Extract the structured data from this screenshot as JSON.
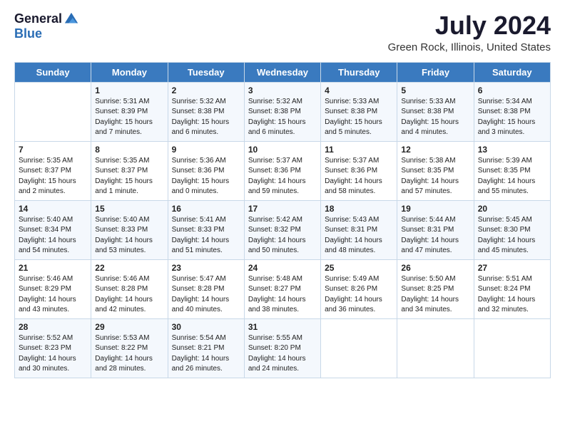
{
  "logo": {
    "general": "General",
    "blue": "Blue"
  },
  "title": {
    "month_year": "July 2024",
    "location": "Green Rock, Illinois, United States"
  },
  "headers": [
    "Sunday",
    "Monday",
    "Tuesday",
    "Wednesday",
    "Thursday",
    "Friday",
    "Saturday"
  ],
  "weeks": [
    [
      {
        "day": "",
        "sunrise": "",
        "sunset": "",
        "daylight": ""
      },
      {
        "day": "1",
        "sunrise": "Sunrise: 5:31 AM",
        "sunset": "Sunset: 8:39 PM",
        "daylight": "Daylight: 15 hours and 7 minutes."
      },
      {
        "day": "2",
        "sunrise": "Sunrise: 5:32 AM",
        "sunset": "Sunset: 8:38 PM",
        "daylight": "Daylight: 15 hours and 6 minutes."
      },
      {
        "day": "3",
        "sunrise": "Sunrise: 5:32 AM",
        "sunset": "Sunset: 8:38 PM",
        "daylight": "Daylight: 15 hours and 6 minutes."
      },
      {
        "day": "4",
        "sunrise": "Sunrise: 5:33 AM",
        "sunset": "Sunset: 8:38 PM",
        "daylight": "Daylight: 15 hours and 5 minutes."
      },
      {
        "day": "5",
        "sunrise": "Sunrise: 5:33 AM",
        "sunset": "Sunset: 8:38 PM",
        "daylight": "Daylight: 15 hours and 4 minutes."
      },
      {
        "day": "6",
        "sunrise": "Sunrise: 5:34 AM",
        "sunset": "Sunset: 8:38 PM",
        "daylight": "Daylight: 15 hours and 3 minutes."
      }
    ],
    [
      {
        "day": "7",
        "sunrise": "Sunrise: 5:35 AM",
        "sunset": "Sunset: 8:37 PM",
        "daylight": "Daylight: 15 hours and 2 minutes."
      },
      {
        "day": "8",
        "sunrise": "Sunrise: 5:35 AM",
        "sunset": "Sunset: 8:37 PM",
        "daylight": "Daylight: 15 hours and 1 minute."
      },
      {
        "day": "9",
        "sunrise": "Sunrise: 5:36 AM",
        "sunset": "Sunset: 8:36 PM",
        "daylight": "Daylight: 15 hours and 0 minutes."
      },
      {
        "day": "10",
        "sunrise": "Sunrise: 5:37 AM",
        "sunset": "Sunset: 8:36 PM",
        "daylight": "Daylight: 14 hours and 59 minutes."
      },
      {
        "day": "11",
        "sunrise": "Sunrise: 5:37 AM",
        "sunset": "Sunset: 8:36 PM",
        "daylight": "Daylight: 14 hours and 58 minutes."
      },
      {
        "day": "12",
        "sunrise": "Sunrise: 5:38 AM",
        "sunset": "Sunset: 8:35 PM",
        "daylight": "Daylight: 14 hours and 57 minutes."
      },
      {
        "day": "13",
        "sunrise": "Sunrise: 5:39 AM",
        "sunset": "Sunset: 8:35 PM",
        "daylight": "Daylight: 14 hours and 55 minutes."
      }
    ],
    [
      {
        "day": "14",
        "sunrise": "Sunrise: 5:40 AM",
        "sunset": "Sunset: 8:34 PM",
        "daylight": "Daylight: 14 hours and 54 minutes."
      },
      {
        "day": "15",
        "sunrise": "Sunrise: 5:40 AM",
        "sunset": "Sunset: 8:33 PM",
        "daylight": "Daylight: 14 hours and 53 minutes."
      },
      {
        "day": "16",
        "sunrise": "Sunrise: 5:41 AM",
        "sunset": "Sunset: 8:33 PM",
        "daylight": "Daylight: 14 hours and 51 minutes."
      },
      {
        "day": "17",
        "sunrise": "Sunrise: 5:42 AM",
        "sunset": "Sunset: 8:32 PM",
        "daylight": "Daylight: 14 hours and 50 minutes."
      },
      {
        "day": "18",
        "sunrise": "Sunrise: 5:43 AM",
        "sunset": "Sunset: 8:31 PM",
        "daylight": "Daylight: 14 hours and 48 minutes."
      },
      {
        "day": "19",
        "sunrise": "Sunrise: 5:44 AM",
        "sunset": "Sunset: 8:31 PM",
        "daylight": "Daylight: 14 hours and 47 minutes."
      },
      {
        "day": "20",
        "sunrise": "Sunrise: 5:45 AM",
        "sunset": "Sunset: 8:30 PM",
        "daylight": "Daylight: 14 hours and 45 minutes."
      }
    ],
    [
      {
        "day": "21",
        "sunrise": "Sunrise: 5:46 AM",
        "sunset": "Sunset: 8:29 PM",
        "daylight": "Daylight: 14 hours and 43 minutes."
      },
      {
        "day": "22",
        "sunrise": "Sunrise: 5:46 AM",
        "sunset": "Sunset: 8:28 PM",
        "daylight": "Daylight: 14 hours and 42 minutes."
      },
      {
        "day": "23",
        "sunrise": "Sunrise: 5:47 AM",
        "sunset": "Sunset: 8:28 PM",
        "daylight": "Daylight: 14 hours and 40 minutes."
      },
      {
        "day": "24",
        "sunrise": "Sunrise: 5:48 AM",
        "sunset": "Sunset: 8:27 PM",
        "daylight": "Daylight: 14 hours and 38 minutes."
      },
      {
        "day": "25",
        "sunrise": "Sunrise: 5:49 AM",
        "sunset": "Sunset: 8:26 PM",
        "daylight": "Daylight: 14 hours and 36 minutes."
      },
      {
        "day": "26",
        "sunrise": "Sunrise: 5:50 AM",
        "sunset": "Sunset: 8:25 PM",
        "daylight": "Daylight: 14 hours and 34 minutes."
      },
      {
        "day": "27",
        "sunrise": "Sunrise: 5:51 AM",
        "sunset": "Sunset: 8:24 PM",
        "daylight": "Daylight: 14 hours and 32 minutes."
      }
    ],
    [
      {
        "day": "28",
        "sunrise": "Sunrise: 5:52 AM",
        "sunset": "Sunset: 8:23 PM",
        "daylight": "Daylight: 14 hours and 30 minutes."
      },
      {
        "day": "29",
        "sunrise": "Sunrise: 5:53 AM",
        "sunset": "Sunset: 8:22 PM",
        "daylight": "Daylight: 14 hours and 28 minutes."
      },
      {
        "day": "30",
        "sunrise": "Sunrise: 5:54 AM",
        "sunset": "Sunset: 8:21 PM",
        "daylight": "Daylight: 14 hours and 26 minutes."
      },
      {
        "day": "31",
        "sunrise": "Sunrise: 5:55 AM",
        "sunset": "Sunset: 8:20 PM",
        "daylight": "Daylight: 14 hours and 24 minutes."
      },
      {
        "day": "",
        "sunrise": "",
        "sunset": "",
        "daylight": ""
      },
      {
        "day": "",
        "sunrise": "",
        "sunset": "",
        "daylight": ""
      },
      {
        "day": "",
        "sunrise": "",
        "sunset": "",
        "daylight": ""
      }
    ]
  ]
}
